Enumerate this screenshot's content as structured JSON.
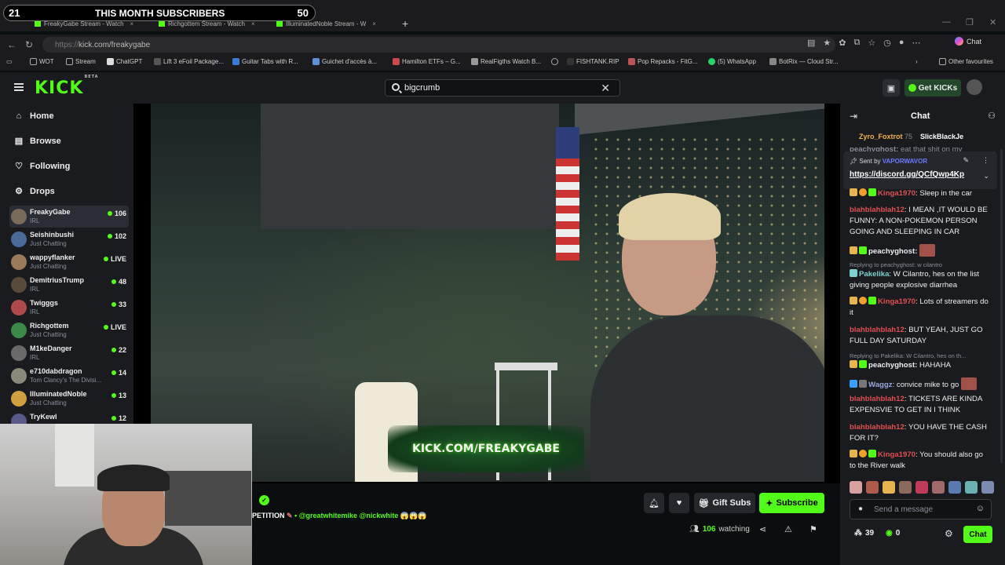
{
  "overlay": {
    "left_num": "21",
    "title": "THIS MONTH SUBSCRIBERS",
    "right_num": "50"
  },
  "browser": {
    "tabs": [
      {
        "label": "FreakyGabe Stream - Watch"
      },
      {
        "label": "Richgottem Stream - Watch"
      },
      {
        "label": "IlluminatedNoble Stream - W"
      }
    ],
    "url_prefix": "https://",
    "url_main": "kick.com/freakygabe",
    "copilot_label": "Chat",
    "bookmarks": [
      "WOT",
      "Stream",
      "ChatGPT",
      "Lift 3 eFoil Package...",
      "Guitar Tabs with R...",
      "Guichet d'accès à...",
      "Hamilton ETFs – G...",
      "RealFigths Watch B...",
      "",
      "FISHTANK.RIP",
      "Pop Repacks - FitG...",
      "(5) WhatsApp",
      "BotRix — Cloud Str...",
      "Other favourites"
    ]
  },
  "kick": {
    "logo": "KICK",
    "logo_beta": "BETA",
    "search_value": "bigcrumb",
    "get_kicks": "Get KICKs",
    "nav": [
      {
        "label": "Home",
        "icon": "home-icon"
      },
      {
        "label": "Browse",
        "icon": "browse-icon"
      },
      {
        "label": "Following",
        "icon": "heart-icon"
      },
      {
        "label": "Drops",
        "icon": "drops-icon"
      }
    ],
    "channels": [
      {
        "name": "FreakyGabe",
        "category": "IRL",
        "viewers": "106",
        "color": "#7a6a5a"
      },
      {
        "name": "Seishinbushi",
        "category": "Just Chatting",
        "viewers": "102",
        "color": "#4a6a9a"
      },
      {
        "name": "wappyflanker",
        "category": "Just Chatting",
        "viewers": "LIVE",
        "color": "#9a7a5a"
      },
      {
        "name": "DemitriusTrump",
        "category": "IRL",
        "viewers": "48",
        "color": "#5a4a3a"
      },
      {
        "name": "Twigggs",
        "category": "IRL",
        "viewers": "33",
        "color": "#b04a4a"
      },
      {
        "name": "Richgottem",
        "category": "Just Chatting",
        "viewers": "LIVE",
        "color": "#3a8a4a"
      },
      {
        "name": "M1keDanger",
        "category": "IRL",
        "viewers": "22",
        "color": "#6a6a6a"
      },
      {
        "name": "e710dabdragon",
        "category": "Tom Clancy's The Divisi...",
        "viewers": "14",
        "color": "#8a8a7a"
      },
      {
        "name": "IlluminatedNoble",
        "category": "Just Chatting",
        "viewers": "13",
        "color": "#d0a040"
      },
      {
        "name": "TryKewl",
        "category": "",
        "viewers": "12",
        "color": "#5a5a8a"
      }
    ],
    "watermark": "KICK.COM/FREAKYGABE",
    "stream_title_start": "PETITION",
    "stream_title_mentions": "@greatwhitemike @nickwhite",
    "stream_title_emoji": "😱😱😱",
    "gift_subs": "Gift Subs",
    "subscribe": "Subscribe",
    "watching_count": "106",
    "watching_label": "watching"
  },
  "chat": {
    "title": "Chat",
    "top_gifters": [
      {
        "name": "Zyro_Foxtrot",
        "count": "75"
      },
      {
        "name": "SlickBlackJe"
      }
    ],
    "pinned_partial_user": "peachyghost:",
    "pinned_partial_text": "eat that shit on my",
    "pinned_sent_by": "Sent by",
    "pinned_user": "VAPORWAVOR",
    "pinned_link": "https://discord.gg/QCfQwp4Kp",
    "messages": [
      {
        "user": "Kinga1970",
        "text": "Sleep in the car",
        "color": "#e05050"
      },
      {
        "user": "blahblahblah12",
        "text": "I MEAN ,IT WOULD BE FUNNY: A NON-POKEMON PERSON GOING AND SLEEPING IN CAR",
        "color": "#e05050"
      },
      {
        "user": "peachyghost:",
        "text": "",
        "color": "#ffffff"
      },
      {
        "user": "Pakelika",
        "text": "W Cilantro, hes on the list giving people explosive diarrhea",
        "color": "#7fd1d1"
      },
      {
        "user": "Kinga1970",
        "text": "Lots of streamers do it",
        "color": "#e05050"
      },
      {
        "user": "blahblahblah12",
        "text": "BUT YEAH, JUST GO FULL DAY SATURDAY",
        "color": "#e05050"
      },
      {
        "user": "peachyghost:",
        "text": "HAHAHA",
        "color": "#ffffff"
      },
      {
        "user": "Waggz",
        "text": "convice mike to go",
        "color": "#ffffff"
      },
      {
        "user": "blahblahblah12",
        "text": "TICKETS ARE KINDA EXPENSVIE TO GET IN I THINK",
        "color": "#e05050"
      },
      {
        "user": "blahblahblah12",
        "text": "YOU HAVE THE CASH FOR IT?",
        "color": "#e05050"
      },
      {
        "user": "Kinga1970",
        "text": "You should also go to the River walk",
        "color": "#e05050"
      }
    ],
    "reply_1": "Replying to peachyghost: w cilantro",
    "reply_2": "Replying to Pakelika: W Cilantro, hes on th...",
    "send_placeholder": "Send a message",
    "footer_count": "39",
    "footer_kicks": "0",
    "chat_button": "Chat"
  }
}
